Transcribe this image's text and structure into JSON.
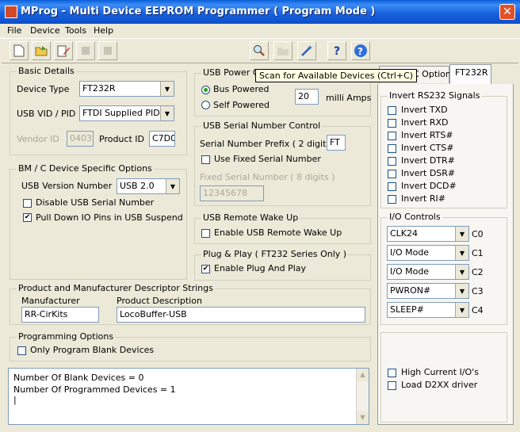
{
  "window": {
    "title": "MProg - Multi Device EEPROM Programmer ( Program Mode )",
    "close": "✕"
  },
  "menu": [
    "File",
    "Device",
    "Tools",
    "Help"
  ],
  "toolbar": {
    "tooltip": "Scan for Available Devices (Ctrl+C)"
  },
  "tabs": [
    "232C Options",
    "FT232R"
  ],
  "basic": {
    "group": "Basic Details",
    "device_type_label": "Device Type",
    "device_type": "FT232R",
    "vidpid_label": "USB VID / PID",
    "vidpid": "FTDI Supplied PID",
    "vendor_id_label": "Vendor ID",
    "vendor_id": "0403",
    "product_id_label": "Product ID",
    "product_id": "C7D0"
  },
  "bm": {
    "group": "BM / C Device Specific Options",
    "usb_version_label": "USB Version Number",
    "usb_version": "USB 2.0",
    "disable_serial": "Disable USB Serial Number",
    "pull_down": "Pull Down IO Pins in USB Suspend"
  },
  "power": {
    "group": "USB Power Options",
    "bus": "Bus Powered",
    "self": "Self Powered",
    "current": "20",
    "unit": "milli Amps"
  },
  "serial": {
    "group": "USB Serial Number Control",
    "prefix_label": "Serial Number Prefix ( 2 digits )",
    "prefix": "FT",
    "use_fixed": "Use Fixed Serial Number",
    "fixed_label": "Fixed Serial Number ( 8 digits )",
    "fixed": "12345678"
  },
  "wake": {
    "group": "USB Remote Wake Up",
    "enable": "Enable USB Remote Wake Up"
  },
  "pnp": {
    "group": "Plug & Play  ( FT232 Series Only )",
    "enable": "Enable Plug And Play"
  },
  "descriptors": {
    "group": "Product and Manufacturer Descriptor Strings",
    "manufacturer_label": "Manufacturer",
    "manufacturer": "RR-CirKits",
    "product_label": "Product Description",
    "product": "LocoBuffer-USB"
  },
  "programming": {
    "group": "Programming Options",
    "only_blank": "Only Program Blank Devices"
  },
  "output": {
    "line1": "Number Of Blank Devices = 0",
    "line2": "Number Of Programmed Devices = 1"
  },
  "invert": {
    "group": "Invert RS232 Signals",
    "items": [
      "Invert TXD",
      "Invert RXD",
      "Invert RTS#",
      "Invert CTS#",
      "Invert DTR#",
      "Invert DSR#",
      "Invert DCD#",
      "Invert RI#"
    ]
  },
  "io": {
    "group": "I/O Controls",
    "values": [
      "CLK24",
      "I/O Mode",
      "I/O Mode",
      "PWRON#",
      "SLEEP#"
    ],
    "labels": [
      "C0",
      "C1",
      "C2",
      "C3",
      "C4"
    ]
  },
  "misc": {
    "high_current": "High Current I/O's",
    "load_d2xx": "Load D2XX driver"
  },
  "colors": {
    "titlebar": "#0a5fd8",
    "dialog": "#ece9d8",
    "tooltip": "#ffffe1"
  }
}
